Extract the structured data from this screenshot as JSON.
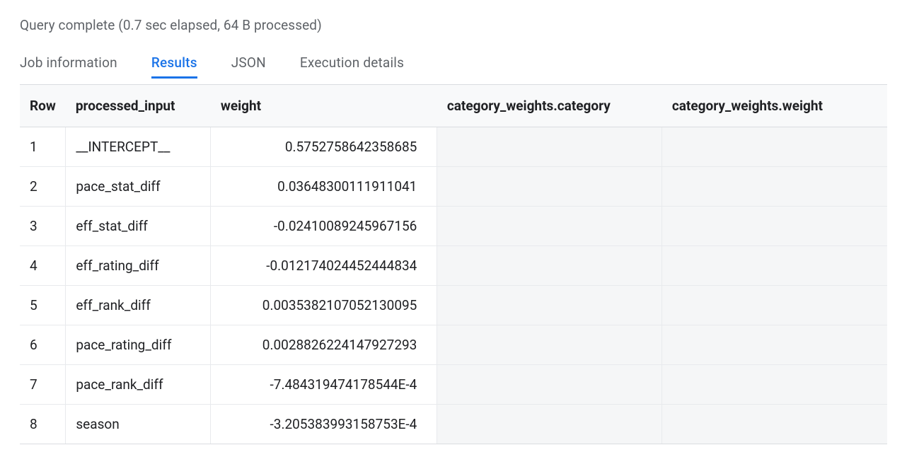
{
  "status": "Query complete (0.7 sec elapsed, 64 B processed)",
  "tabs": [
    {
      "label": "Job information",
      "active": false
    },
    {
      "label": "Results",
      "active": true
    },
    {
      "label": "JSON",
      "active": false
    },
    {
      "label": "Execution details",
      "active": false
    }
  ],
  "table": {
    "headers": {
      "row": "Row",
      "processed_input": "processed_input",
      "weight": "weight",
      "category_weights_category": "category_weights.category",
      "category_weights_weight": "category_weights.weight"
    },
    "rows": [
      {
        "row": "1",
        "processed_input": "__INTERCEPT__",
        "weight": "0.5752758642358685",
        "cw_category": "",
        "cw_weight": ""
      },
      {
        "row": "2",
        "processed_input": "pace_stat_diff",
        "weight": "0.03648300111911041",
        "cw_category": "",
        "cw_weight": ""
      },
      {
        "row": "3",
        "processed_input": "eff_stat_diff",
        "weight": "-0.02410089245967156",
        "cw_category": "",
        "cw_weight": ""
      },
      {
        "row": "4",
        "processed_input": "eff_rating_diff",
        "weight": "-0.012174024452444834",
        "cw_category": "",
        "cw_weight": ""
      },
      {
        "row": "5",
        "processed_input": "eff_rank_diff",
        "weight": "0.0035382107052130095",
        "cw_category": "",
        "cw_weight": ""
      },
      {
        "row": "6",
        "processed_input": "pace_rating_diff",
        "weight": "0.0028826224147927293",
        "cw_category": "",
        "cw_weight": ""
      },
      {
        "row": "7",
        "processed_input": "pace_rank_diff",
        "weight": "-7.484319474178544E-4",
        "cw_category": "",
        "cw_weight": ""
      },
      {
        "row": "8",
        "processed_input": "season",
        "weight": "-3.205383993158753E-4",
        "cw_category": "",
        "cw_weight": ""
      }
    ]
  }
}
